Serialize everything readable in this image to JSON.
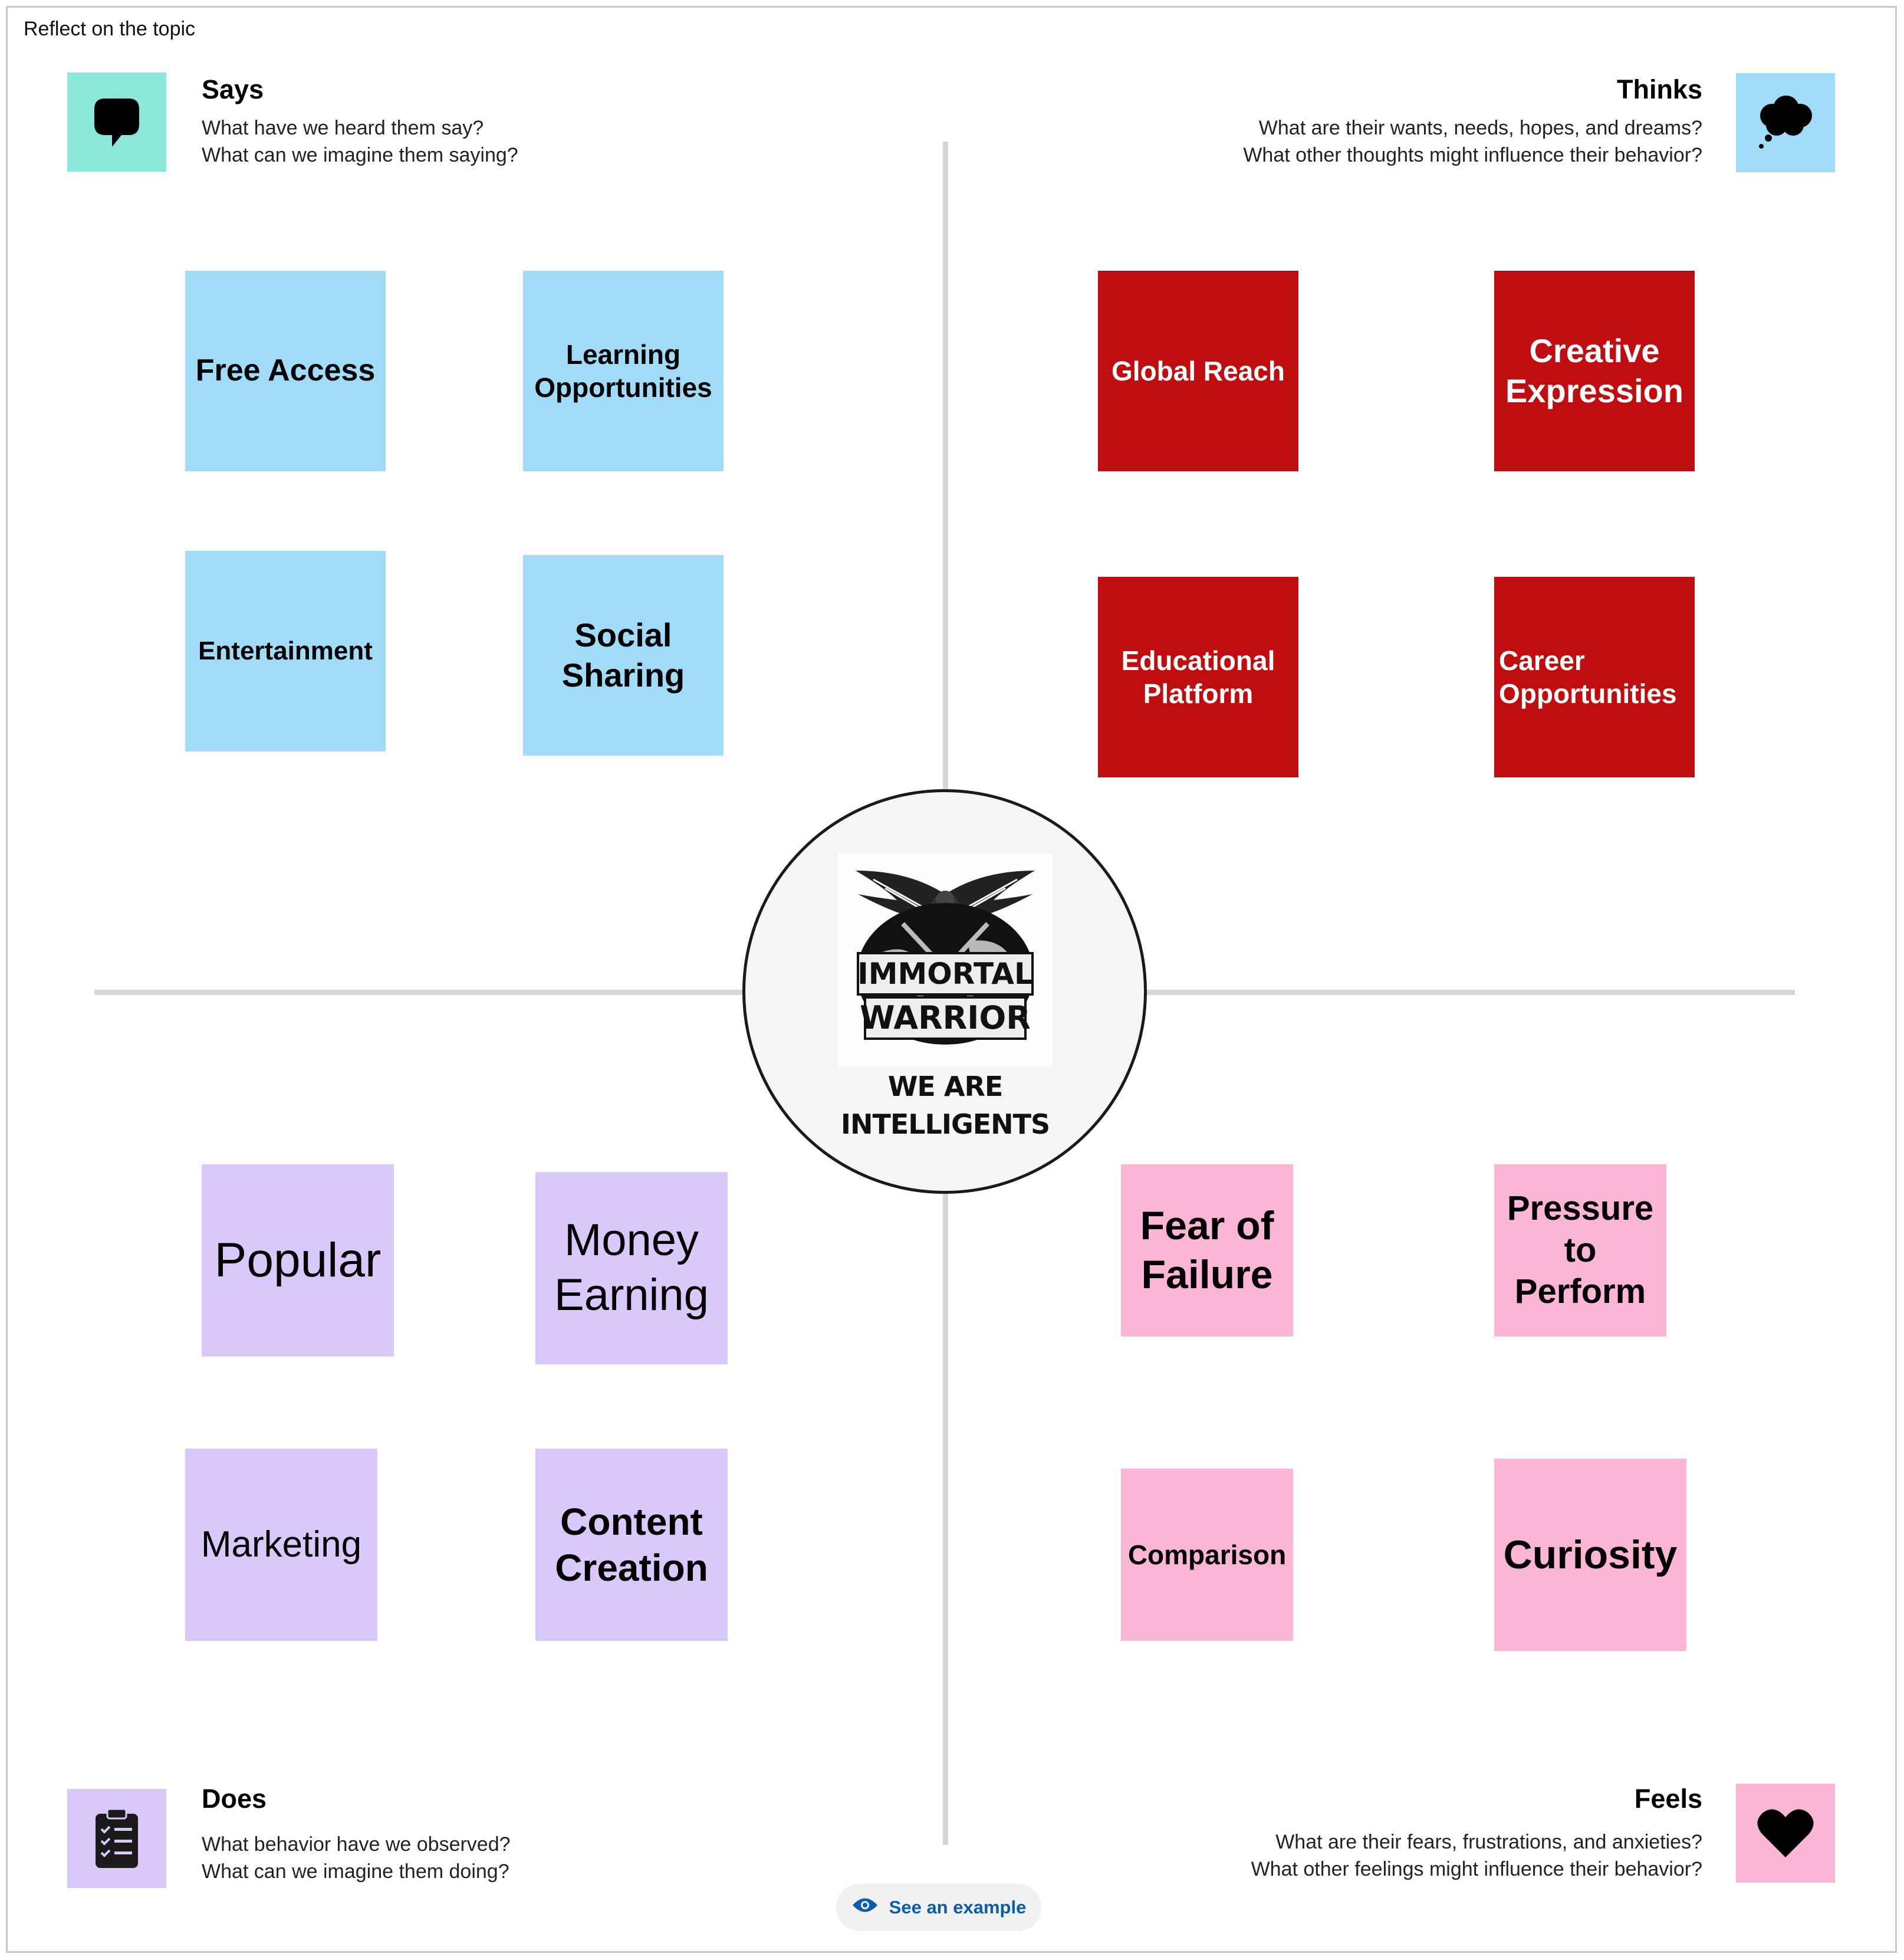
{
  "topic": "Reflect on the topic",
  "quadrants": {
    "says": {
      "title": "Says",
      "line1": "What have we heard them say?",
      "line2": "What can we imagine them saying?",
      "icon": "speech-bubble-icon",
      "icon_bg": "#8de8dc"
    },
    "thinks": {
      "title": "Thinks",
      "line1": "What are their wants, needs, hopes, and dreams?",
      "line2": "What other thoughts might influence their behavior?",
      "icon": "thought-cloud-icon",
      "icon_bg": "#a0dcf7"
    },
    "does": {
      "title": "Does",
      "line1": "What behavior have we observed?",
      "line2": "What can we imagine them doing?",
      "icon": "clipboard-checklist-icon",
      "icon_bg": "#d9c9fb"
    },
    "feels": {
      "title": "Feels",
      "line1": "What are their fears, frustrations, and anxieties?",
      "line2": "What other feelings might influence their behavior?",
      "icon": "heart-icon",
      "icon_bg": "#fbb5d5"
    }
  },
  "notes": {
    "says": [
      "Free Access",
      "Learning Opportunities",
      "Entertainment",
      "Social Sharing"
    ],
    "thinks": [
      "Global Reach",
      "Creative Expression",
      "Educational Platform",
      "Career Opportunities"
    ],
    "does": [
      "Popular",
      "Money Earning",
      "Marketing",
      "Content Creation"
    ],
    "feels": [
      "Fear of Failure",
      "Pressure to Perform",
      "Comparison",
      "Curiosity"
    ]
  },
  "center": {
    "logo_line1": "IMMORTAL",
    "logo_line2": "WARRIOR",
    "caption_line1": "WE ARE",
    "caption_line2": "INTELLIGENTS"
  },
  "see_example": "See an example",
  "colors": {
    "says_note": "#a0dcf7",
    "thinks_note": "#c00d0f",
    "does_note": "#d9c9fb",
    "feels_note": "#fbb5d5",
    "link": "#0b5cab"
  }
}
